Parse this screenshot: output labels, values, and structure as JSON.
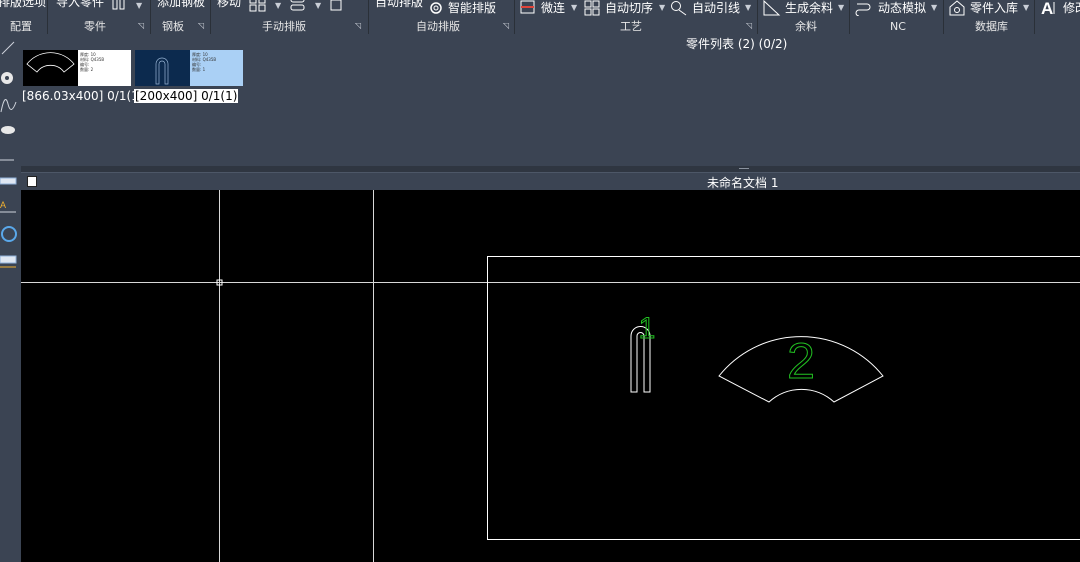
{
  "ribbon": {
    "buttons": {
      "nest_options": "排版选项",
      "import_part": "导入零件",
      "add_plate": "添加钢板",
      "move": "移动",
      "auto_nest": "自动排版",
      "smart_nest": "智能排版",
      "micro_joint": "微连",
      "auto_sequence": "自动切序",
      "auto_leadin": "自动引线",
      "gen_remnant": "生成余料",
      "dynamic_sim": "动态模拟",
      "part_to_db": "零件入库",
      "modify": "修改"
    },
    "groups": {
      "config": "配置",
      "parts": "零件",
      "plate": "钢板",
      "manual_nest": "手动排版",
      "auto_nest": "自动排版",
      "process": "工艺",
      "remnant": "余料",
      "nc": "NC",
      "database": "数据库"
    }
  },
  "parts_list": {
    "title": "零件列表 (2) (0/2)",
    "items": [
      {
        "caption": "[866.03x400] 0/1(1)",
        "selected": false,
        "info": [
          "厚度: 10",
          "材料: Q435B",
          "编号:",
          "数量: 2"
        ]
      },
      {
        "caption": "[200x400] 0/1(1)",
        "selected": true,
        "info": [
          "厚度: 10",
          "材料: Q435B",
          "编号:",
          "数量: 1"
        ]
      }
    ]
  },
  "document": {
    "title": "未命名文档 1"
  },
  "canvas": {
    "part_labels": [
      "1",
      "2"
    ]
  },
  "colors": {
    "ribbon_bg": "#3b4453",
    "canvas_bg": "#000000",
    "part_outline": "#ffffff",
    "part_label": "#22c222",
    "selection_highlight": "#aad0f5"
  }
}
